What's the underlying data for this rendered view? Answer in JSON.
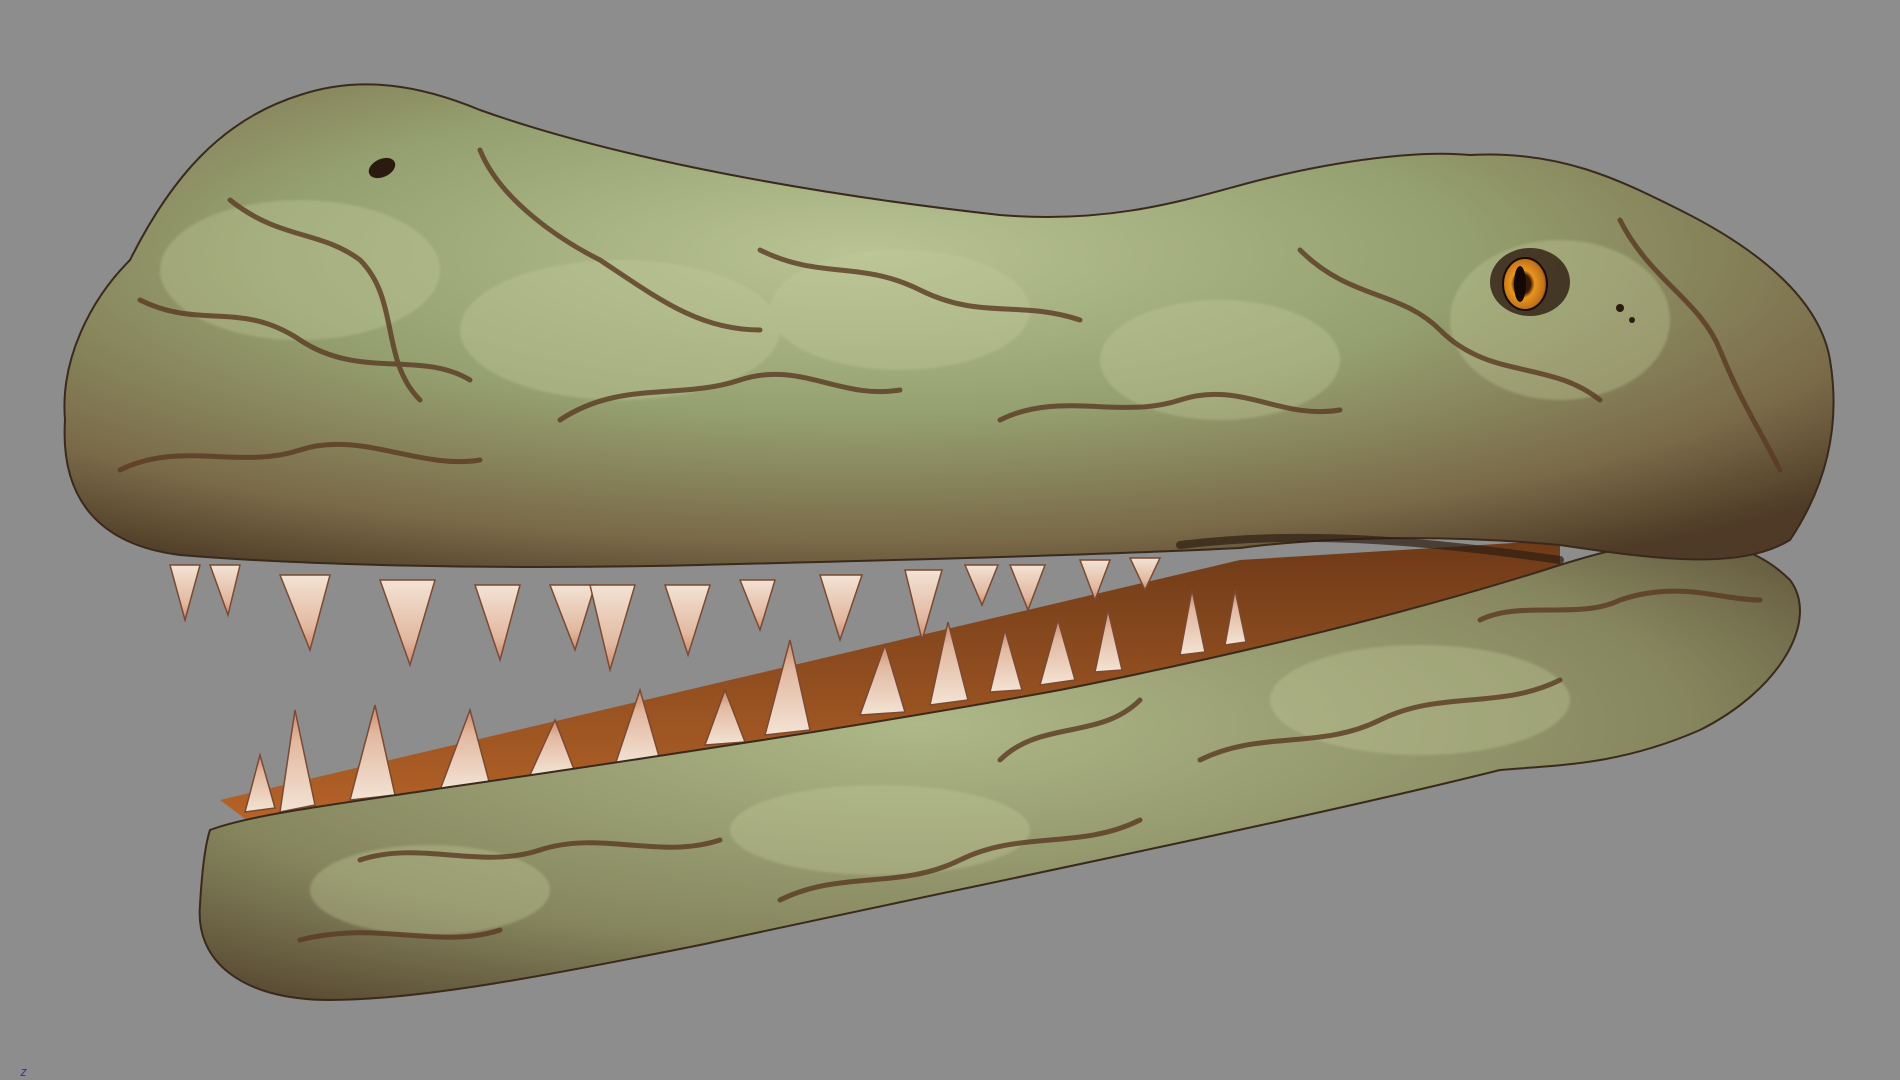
{
  "viewport": {
    "background_color": "#8d8d8d",
    "model_name": "crocodile-head-model",
    "skin_colors": {
      "base": "#8e9a6a",
      "highlight": "#b7c28e",
      "vein": "#5a3a22",
      "shadow": "#3a2a1c"
    },
    "tooth_color": "#e9d2c0",
    "gum_color": "#a0521f",
    "eye_color": "#e08a1e"
  },
  "axis_indicator": {
    "label": "z",
    "color": "#2b2bd6"
  }
}
